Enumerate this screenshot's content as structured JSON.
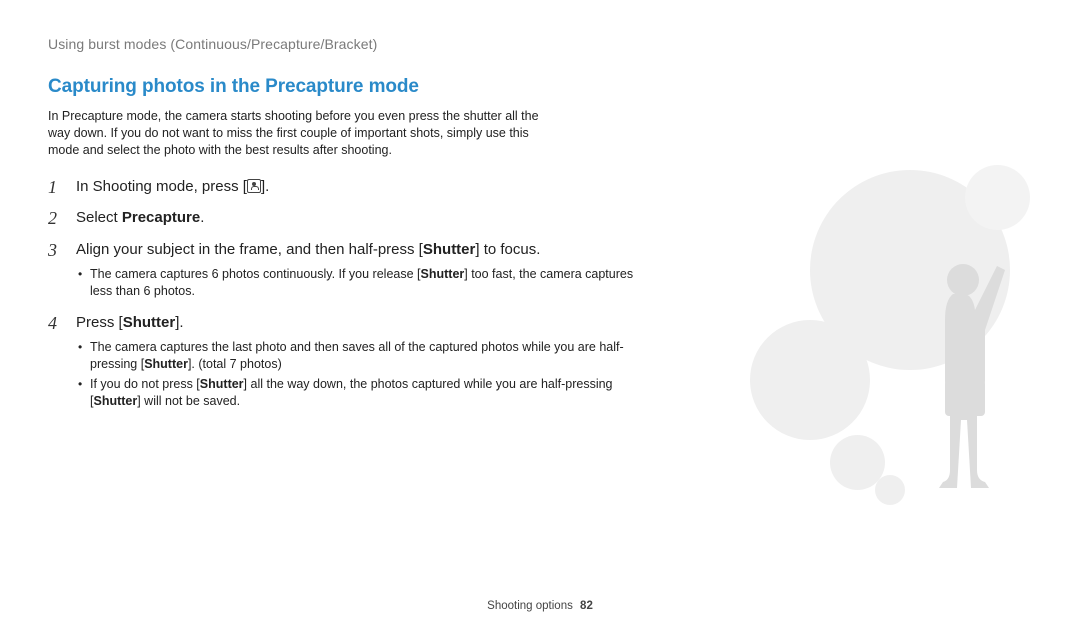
{
  "breadcrumb": "Using burst modes (Continuous/Precapture/Bracket)",
  "heading": "Capturing photos in the Precapture mode",
  "intro": "In Precapture mode, the camera starts shooting before you even press the shutter all the way down. If you do not want to miss the first couple of important shots, simply use this mode and select the photo with the best results after shooting.",
  "steps": {
    "s1": {
      "num": "1",
      "prefix": "In Shooting mode, press [",
      "suffix": "]."
    },
    "s2": {
      "num": "2",
      "prefix": "Select ",
      "bold": "Precapture",
      "suffix": "."
    },
    "s3": {
      "num": "3",
      "part1": "Align your subject in the frame, and then half-press [",
      "bold1": "Shutter",
      "part2": "] to focus.",
      "bullets": {
        "b1a": "The camera captures 6 photos continuously. If you release [",
        "b1bold": "Shutter",
        "b1b": "] too fast, the camera captures less than 6 photos."
      }
    },
    "s4": {
      "num": "4",
      "prefix": "Press [",
      "bold": "Shutter",
      "suffix": "].",
      "bullets": {
        "b1a": "The camera captures the last photo and then saves all of the captured photos while you are half-pressing [",
        "b1bold": "Shutter",
        "b1b": "]. (total 7 photos)",
        "b2a": "If you do not press [",
        "b2bold1": "Shutter",
        "b2b": "] all the way down, the photos captured while you are half-pressing [",
        "b2bold2": "Shutter",
        "b2c": "] will not be saved."
      }
    }
  },
  "footer": {
    "section": "Shooting options",
    "page": "82"
  }
}
